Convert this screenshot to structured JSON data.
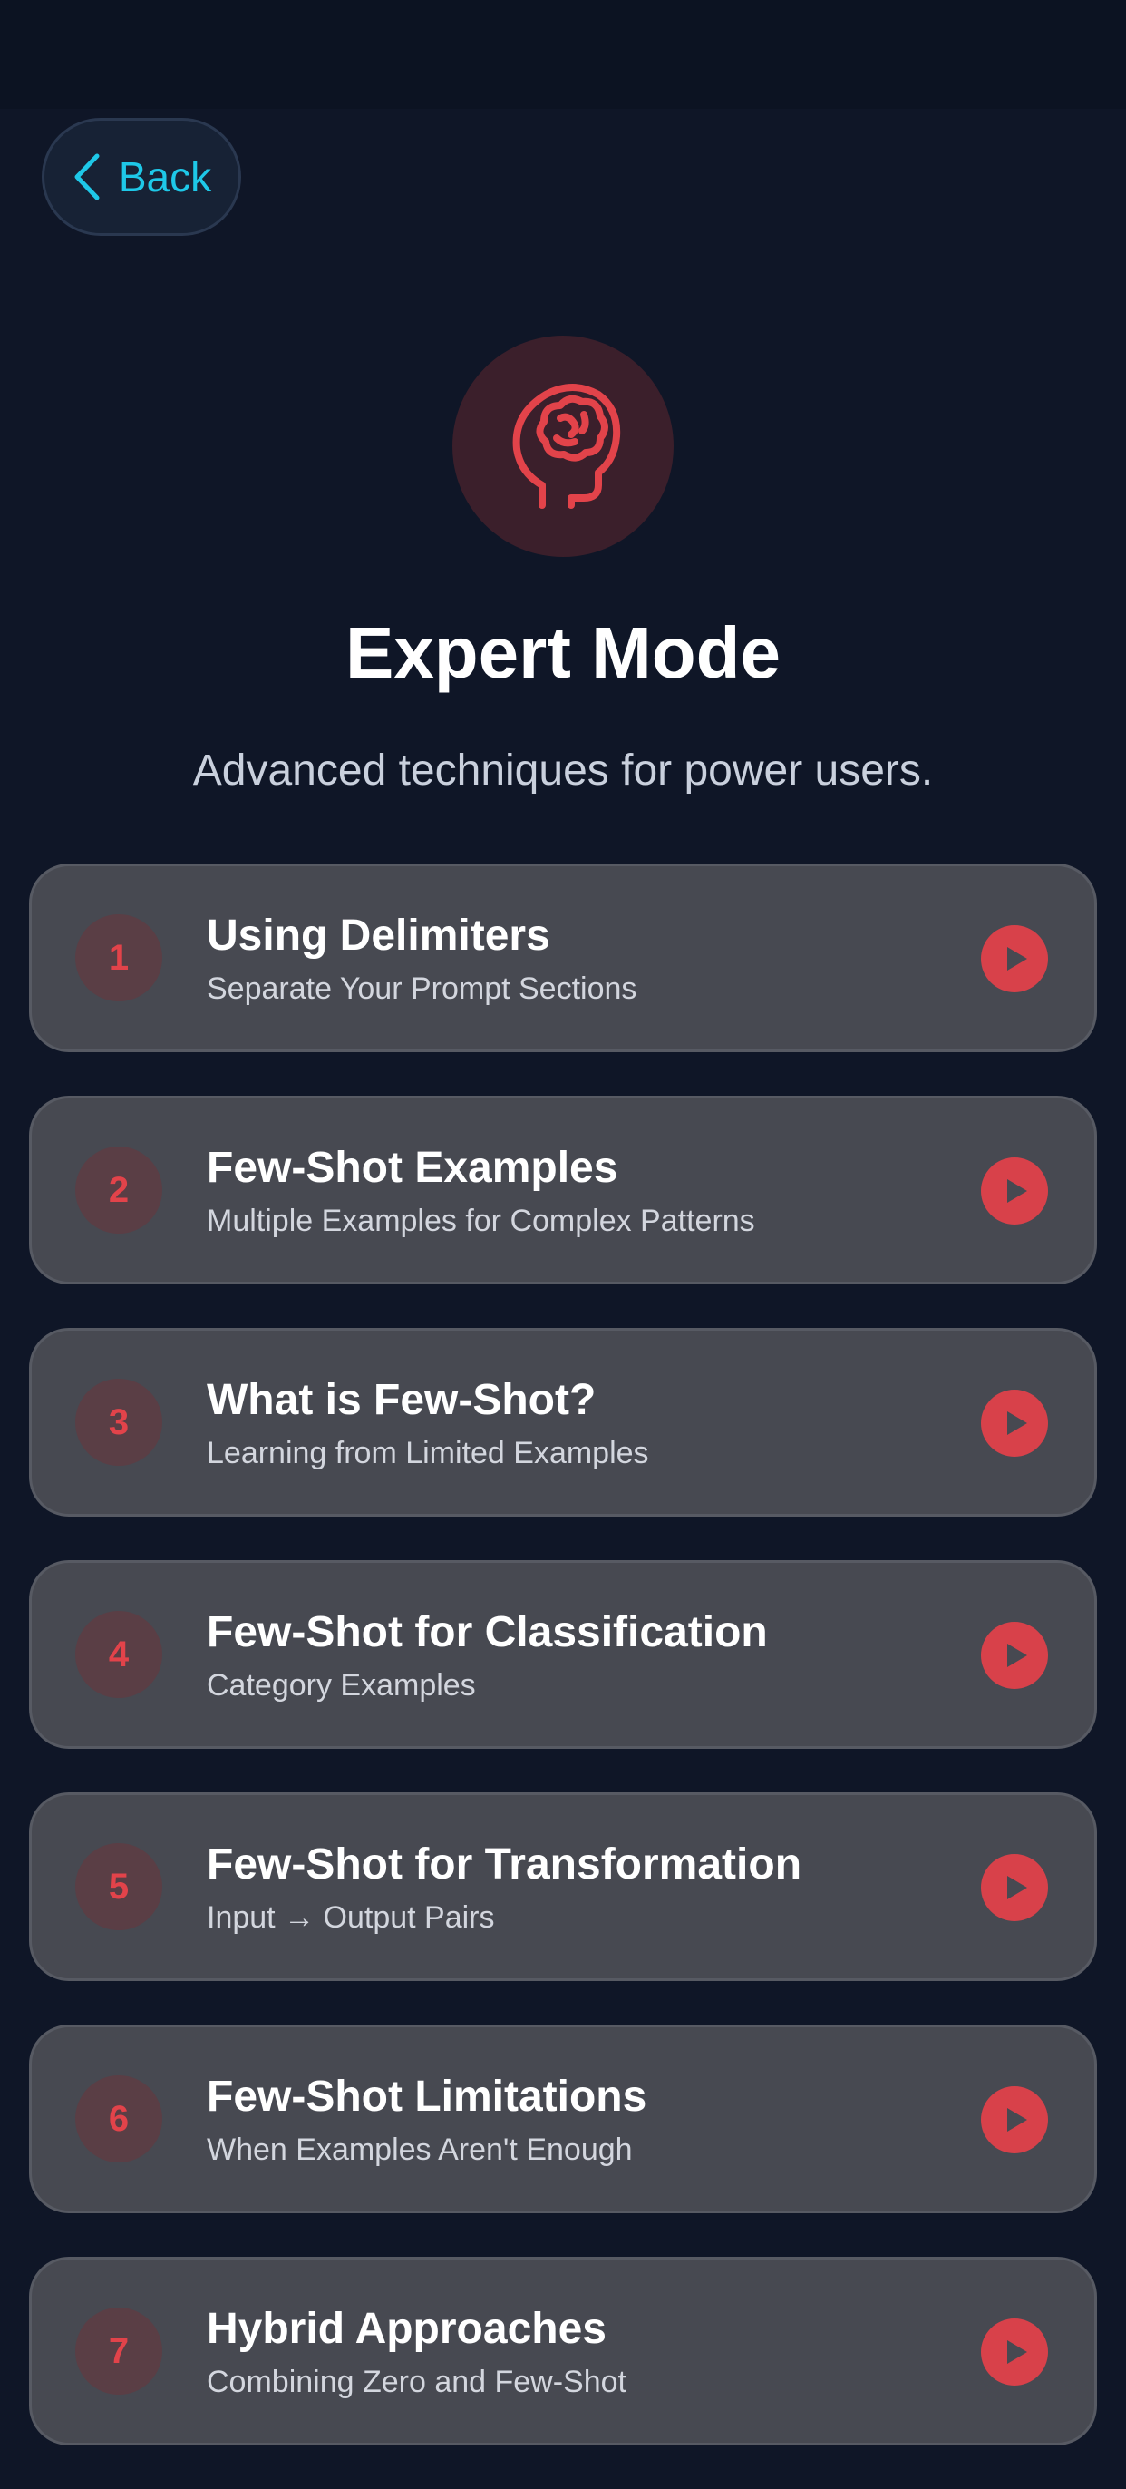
{
  "nav": {
    "back_label": "Back"
  },
  "header": {
    "icon": "brain-head-icon",
    "title": "Expert Mode",
    "subtitle": "Advanced techniques for power users."
  },
  "lessons": [
    {
      "number": "1",
      "title": "Using Delimiters",
      "subtitle": "Separate Your Prompt Sections"
    },
    {
      "number": "2",
      "title": "Few-Shot Examples",
      "subtitle": "Multiple Examples for Complex Patterns"
    },
    {
      "number": "3",
      "title": "What is Few-Shot?",
      "subtitle": "Learning from Limited Examples"
    },
    {
      "number": "4",
      "title": "Few-Shot for Classification",
      "subtitle": "Category Examples"
    },
    {
      "number": "5",
      "title": "Few-Shot for Transformation",
      "subtitle": "Input → Output Pairs"
    },
    {
      "number": "6",
      "title": "Few-Shot Limitations",
      "subtitle": "When Examples Aren't Enough"
    },
    {
      "number": "7",
      "title": "Hybrid Approaches",
      "subtitle": "Combining Zero and Few-Shot"
    }
  ],
  "colors": {
    "background": "#0f1627",
    "accent": "#1ec8e8",
    "expert_red": "#e2434a",
    "card": "#474951"
  }
}
